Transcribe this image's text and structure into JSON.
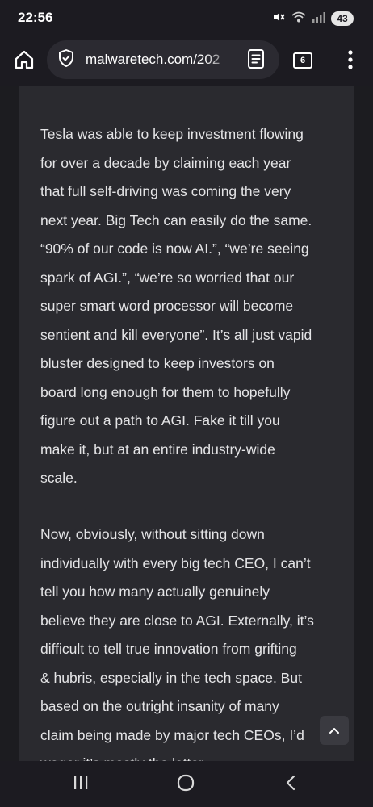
{
  "status_bar": {
    "time": "22:56",
    "battery": "43",
    "icons": [
      "mute-icon",
      "wifi-icon",
      "signal-icon"
    ]
  },
  "toolbar": {
    "url": "malwaretech.com/202",
    "tab_count": "6",
    "icons": [
      "home-icon",
      "site-info-icon",
      "reader-mode-icon",
      "menu-icon"
    ]
  },
  "article": {
    "paragraphs": [
      {
        "lines": [
          "Tesla was able to keep investment flowing",
          "for over a decade by claiming each year",
          "that full self-driving was coming the very",
          "next year. Big Tech can easily do the same.",
          "“90% of our code is now AI.”, “we’re seeing",
          "spark of AGI.”, “we’re so worried that our",
          "super smart word processor will become",
          "sentient and kill everyone”. It’s all just vapid",
          "bluster designed to keep investors on",
          "board long enough for them to hopefully",
          "figure out a path to AGI. Fake it till you",
          "make it, but at an entire industry-wide",
          "scale."
        ]
      },
      {
        "lines": [
          "Now, obviously, without sitting down",
          "individually with every big tech CEO, I can’t",
          "tell you how many actually genuinely",
          "believe they are close to AGI. Externally, it’s",
          "difficult to tell true innovation from grifting",
          "& hubris, especially in the tech space. But",
          "based on the outright insanity of many",
          "claim being made by major tech CEOs, I’d",
          "wager it’s mostly the latter."
        ]
      }
    ]
  },
  "nav_bar": {
    "icons": [
      "recents-icon",
      "home-circle-icon",
      "back-icon"
    ]
  }
}
